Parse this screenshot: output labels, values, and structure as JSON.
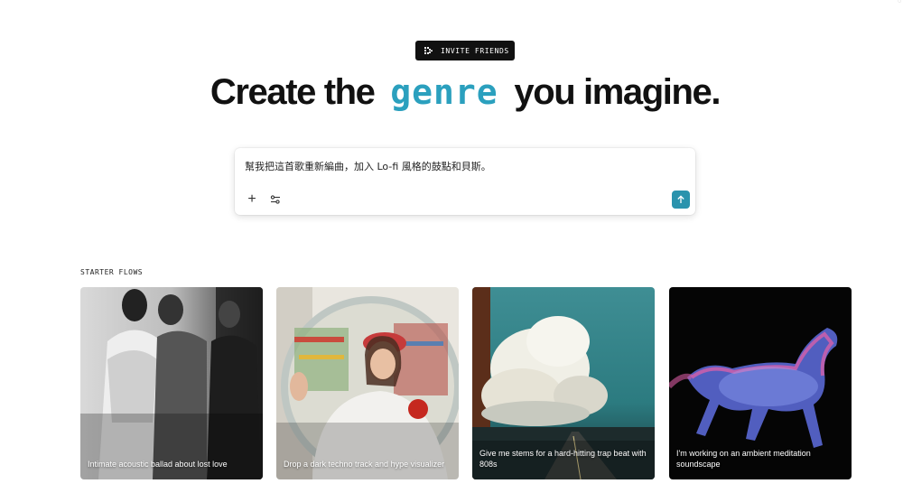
{
  "header": {
    "invite_label": "INVITE FRIENDS",
    "invite_icon": "invite-icon"
  },
  "hero": {
    "title_before": "Create the",
    "title_accent": "genre",
    "title_after": "you imagine.",
    "accent_color": "#2ba0be"
  },
  "prompt": {
    "value": "幫我把這首歌重新編曲，加入 Lo-fi 風格的鼓點和貝斯。",
    "add_icon": "plus-icon",
    "settings_icon": "settings-sliders-icon",
    "send_icon": "arrow-up-icon",
    "send_color": "#2a93ad"
  },
  "starter_flows": {
    "label": "STARTER FLOWS",
    "cards": [
      {
        "caption": "Intimate acoustic ballad about lost love"
      },
      {
        "caption": "Drop a dark techno track and hype visualizer"
      },
      {
        "caption": "Give me stems for a hard-hitting trap beat with 808s"
      },
      {
        "caption": "I'm working on an ambient meditation soundscape"
      }
    ]
  }
}
